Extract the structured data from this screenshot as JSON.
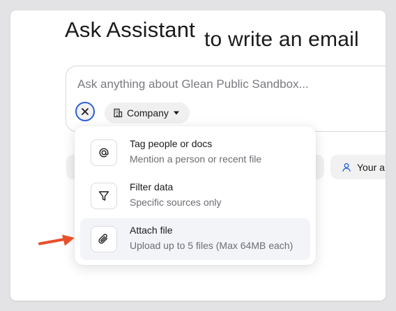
{
  "title": {
    "main": "Ask Assistant",
    "suffix": "to write an email"
  },
  "input": {
    "placeholder": "Ask anything about Glean Public Sandbox..."
  },
  "chip": {
    "label": "Company",
    "icon": "building-icon"
  },
  "side_pill": {
    "label": "Your a"
  },
  "menu": [
    {
      "title": "Tag people or docs",
      "subtitle": "Mention a person or recent file",
      "icon": "at-icon"
    },
    {
      "title": "Filter data",
      "subtitle": "Specific sources only",
      "icon": "filter-icon"
    },
    {
      "title": "Attach file",
      "subtitle": "Upload up to 5 files (Max 64MB each)",
      "icon": "paperclip-icon"
    }
  ],
  "colors": {
    "accent": "#2b5fd9",
    "arrow": "#e8502a",
    "highlight": "#f3f4f8"
  }
}
